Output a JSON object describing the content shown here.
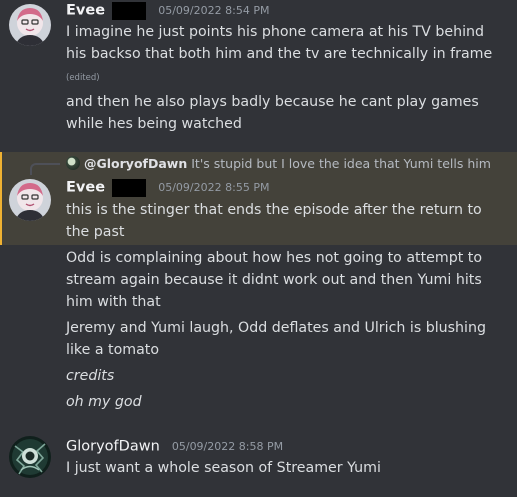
{
  "messages": [
    {
      "author": "Evee",
      "timestamp": "05/09/2022 8:54 PM",
      "lines": [
        "I imagine he just points his phone camera at his TV behind his backso that both him and the tv are technically in frame",
        "and then he also plays badly because he cant play games while hes being watched"
      ],
      "edited_label": "(edited)"
    },
    {
      "reply": {
        "name": "@GloryofDawn",
        "preview": "It's stupid but I love the idea that Yumi tells him"
      },
      "author": "Evee",
      "timestamp": "05/09/2022 8:55 PM",
      "lines": [
        "this is the stinger that ends the episode after the return to the past",
        "Odd is complaining about how hes not going to attempt to stream again because it didnt work out and then Yumi hits him with that",
        "Jeremy and Yumi laugh, Odd deflates and Ulrich is blushing like a tomato",
        "credits",
        "oh my god"
      ]
    },
    {
      "author": "GloryofDawn",
      "timestamp": "05/09/2022 8:58 PM",
      "lines": [
        "I just want a whole season of Streamer Yumi"
      ]
    }
  ],
  "colors": {
    "background": "#313338",
    "highlight_background": "#44423a",
    "highlight_bar": "#f0b232",
    "text": "#dbdee1",
    "muted": "#949ba4"
  }
}
